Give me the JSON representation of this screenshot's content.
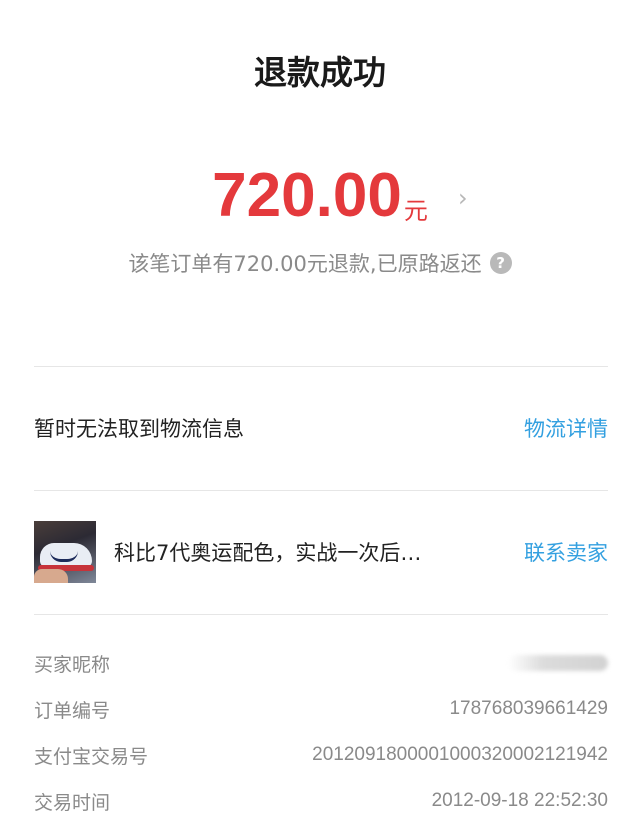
{
  "header": {
    "title": "退款成功"
  },
  "refund": {
    "amount": "720.00",
    "currency": "元",
    "detail_icon": "chevron-right-icon",
    "note": "该笔订单有720.00元退款,已原路返还",
    "help_icon": "question-circle-icon",
    "help_glyph": "?"
  },
  "logistics": {
    "label": "暂时无法取到物流信息",
    "link": "物流详情"
  },
  "product": {
    "name": "科比7代奥运配色，实战一次后…",
    "contact": "联系卖家"
  },
  "info": [
    {
      "label": "买家昵称",
      "value": ""
    },
    {
      "label": "订单编号",
      "value": "178768039661429"
    },
    {
      "label": "支付宝交易号",
      "value": "2012091800001000320002121942"
    },
    {
      "label": "交易时间",
      "value": "2012-09-18 22:52:30"
    }
  ],
  "colors": {
    "amount": "#e4393c",
    "link": "#33a0e0",
    "muted": "#8a8a8a"
  }
}
